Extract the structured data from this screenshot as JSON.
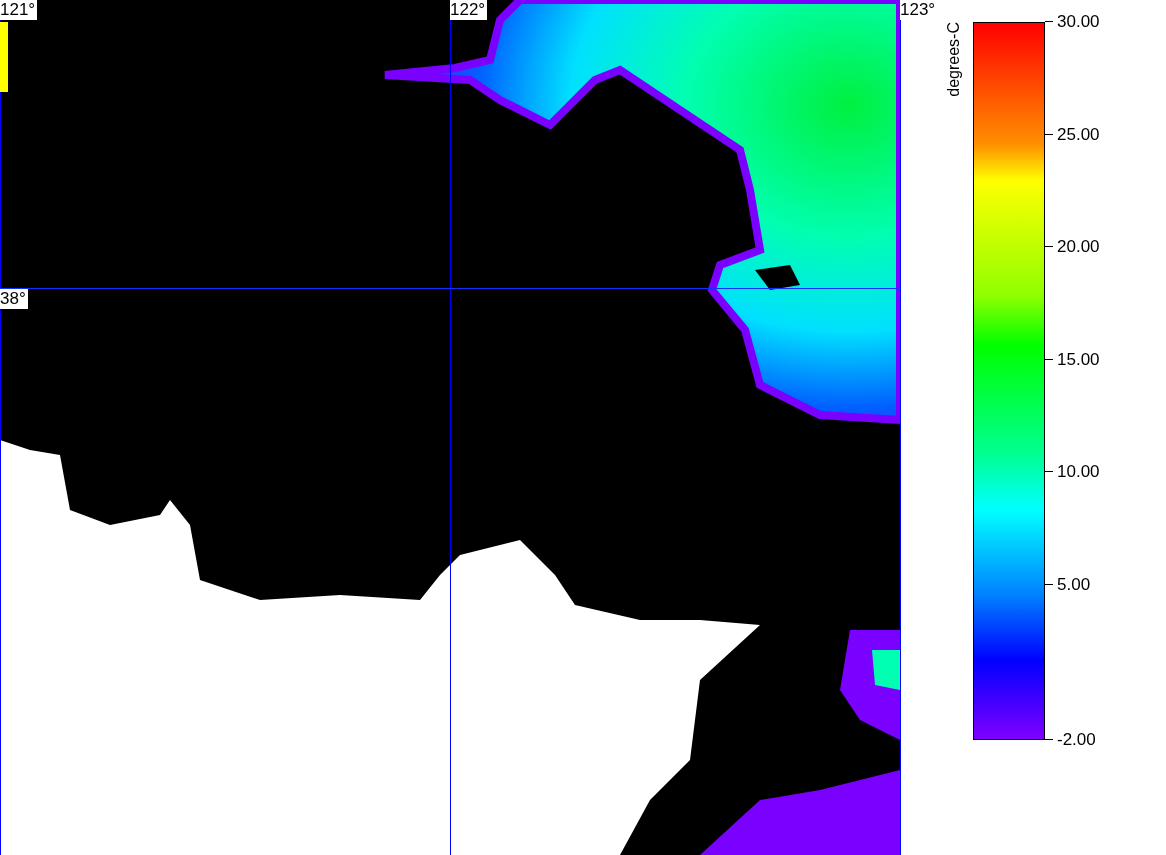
{
  "map": {
    "lon_labels": [
      "121°",
      "122°",
      "123°"
    ],
    "lat_labels": [
      "38°"
    ]
  },
  "legend": {
    "title": "degrees-C",
    "ticks": [
      "30.00",
      "25.00",
      "20.00",
      "15.00",
      "10.00",
      "5.00",
      "-2.00"
    ]
  }
}
